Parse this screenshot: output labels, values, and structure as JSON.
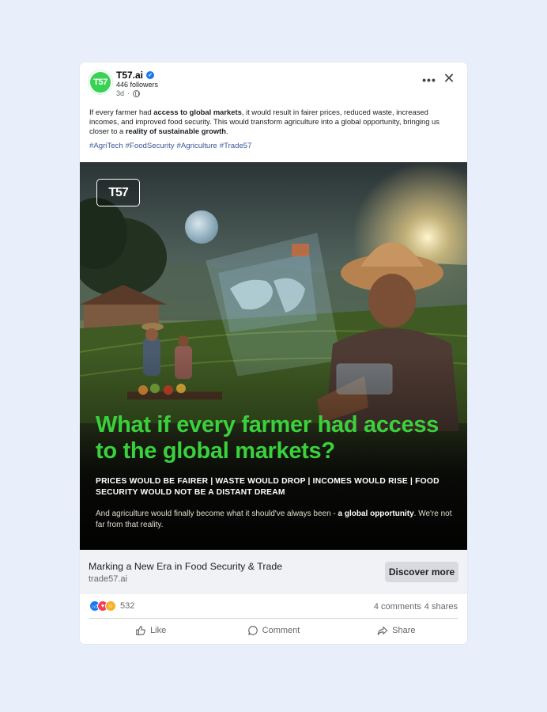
{
  "post": {
    "page_name": "T57.ai",
    "avatar_text": "T57",
    "followers": "446 followers",
    "time": "3d",
    "time_separator": "·",
    "body_parts": [
      "If every farmer had ",
      "access to global markets",
      ", it would result in fairer prices, reduced waste, increased incomes, and improved food security. This would transform agriculture into a global opportunity, bringing us closer to a ",
      "reality of sustainable growth",
      "."
    ],
    "hashtags": [
      "#AgriTech",
      "#FoodSecurity",
      "#Agriculture",
      "#Trade57"
    ]
  },
  "image": {
    "logo": "T57",
    "headline": "What if every farmer had access to the global markets?",
    "stats": "PRICES WOULD BE FAIRER  |  WASTE WOULD DROP  |  INCOMES WOULD RISE  |  FOOD SECURITY WOULD NOT BE A DISTANT DREAM",
    "sub_parts": [
      "And agriculture would finally become what it should've always been - ",
      "a global opportunity",
      ". We're not far from that reality."
    ]
  },
  "link": {
    "title": "Marking a New Era in Food Security & Trade",
    "domain": "trade57.ai",
    "button": "Discover more"
  },
  "engagement": {
    "reaction_count": "532",
    "comments": "4 comments",
    "shares": "4 shares",
    "reactions": [
      "like-icon",
      "love-icon",
      "care-icon"
    ]
  },
  "actions": {
    "like": "Like",
    "comment": "Comment",
    "share": "Share"
  },
  "colors": {
    "background": "#e8eefa",
    "headline_green": "#3ad13c",
    "link_blue": "#385898",
    "avatar_green": "#39d353"
  }
}
